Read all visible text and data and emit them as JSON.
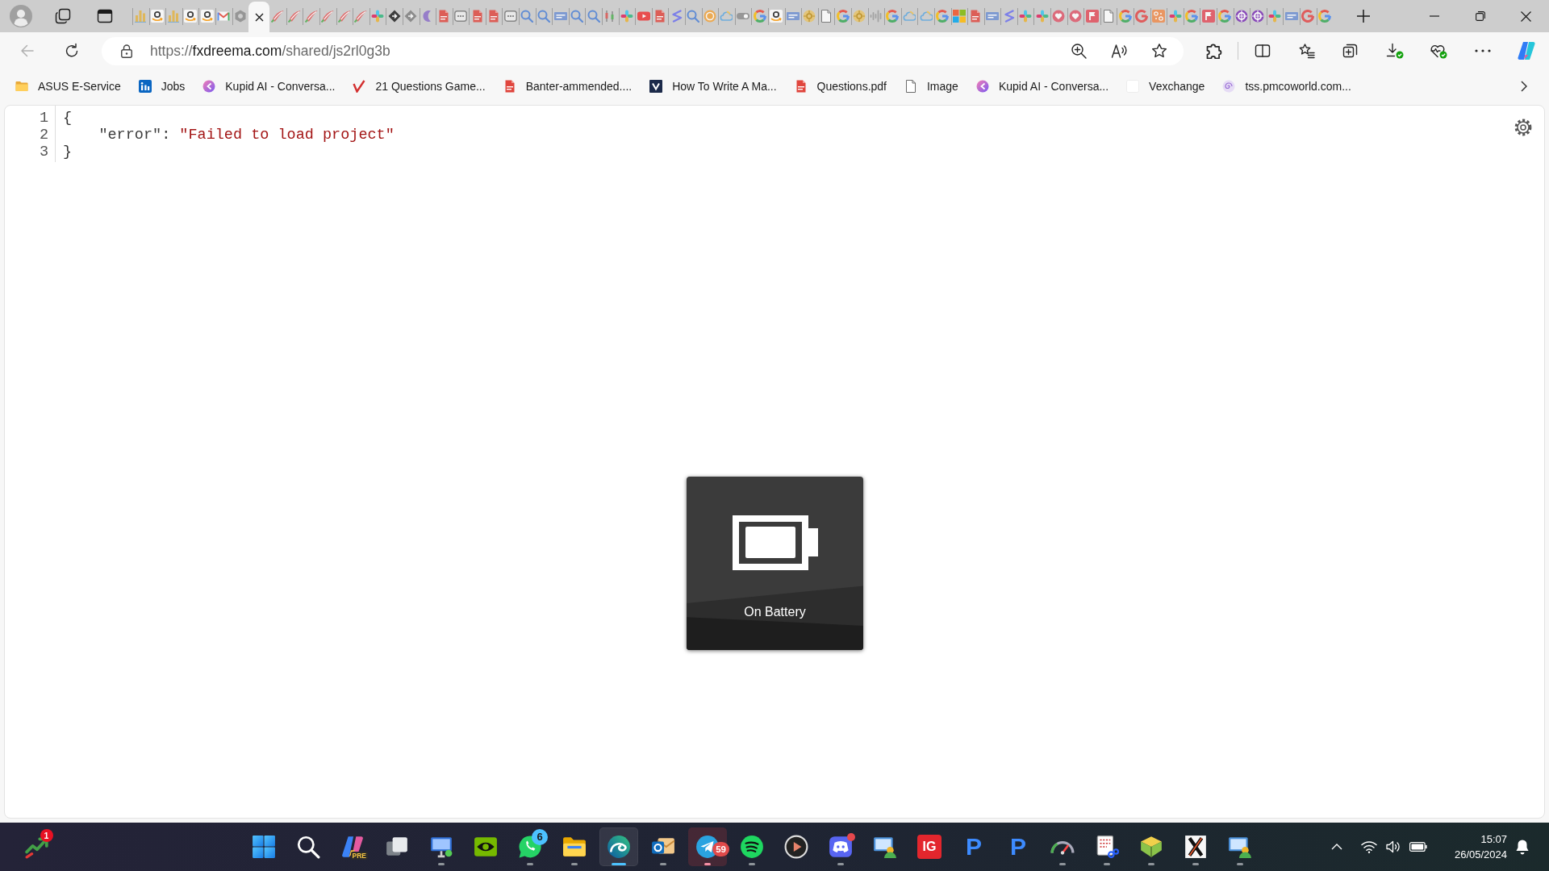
{
  "tab_strip": {
    "tabs": [
      {
        "kind": "bars",
        "selected": false
      },
      {
        "kind": "smile",
        "selected": false
      },
      {
        "kind": "bars",
        "selected": false
      },
      {
        "kind": "smile",
        "selected": false
      },
      {
        "kind": "smile",
        "selected": false
      },
      {
        "kind": "envelope",
        "selected": false
      },
      {
        "kind": "hexagon",
        "selected": false
      },
      {
        "selected": true
      },
      {
        "kind": "swoosh",
        "selected": false
      },
      {
        "kind": "swoosh",
        "selected": false
      },
      {
        "kind": "swoosh",
        "selected": false
      },
      {
        "kind": "swoosh",
        "selected": false
      },
      {
        "kind": "swoosh",
        "selected": false
      },
      {
        "kind": "swoosh",
        "selected": false
      },
      {
        "kind": "dots",
        "selected": false
      },
      {
        "kind": "diamond",
        "selected": false
      },
      {
        "kind": "diamond_light",
        "selected": false
      },
      {
        "kind": "crescent",
        "selected": false
      },
      {
        "kind": "pdf",
        "selected": false
      },
      {
        "kind": "chat",
        "selected": false
      },
      {
        "kind": "pdf",
        "selected": false
      },
      {
        "kind": "pdf",
        "selected": false
      },
      {
        "kind": "chat",
        "selected": false
      },
      {
        "kind": "search",
        "selected": false
      },
      {
        "kind": "search",
        "selected": false
      },
      {
        "kind": "tag",
        "selected": false
      },
      {
        "kind": "search",
        "selected": false
      },
      {
        "kind": "search",
        "selected": false
      },
      {
        "kind": "candles",
        "selected": false
      },
      {
        "kind": "dots",
        "selected": false
      },
      {
        "kind": "play",
        "selected": false
      },
      {
        "kind": "pdf",
        "selected": false
      },
      {
        "kind": "zigzag",
        "selected": false
      },
      {
        "kind": "search",
        "selected": false
      },
      {
        "kind": "coin",
        "selected": false
      },
      {
        "kind": "cloud",
        "selected": false
      },
      {
        "kind": "toggle",
        "selected": false
      },
      {
        "kind": "ring",
        "selected": false
      },
      {
        "kind": "smile",
        "selected": false
      },
      {
        "kind": "tag",
        "selected": false
      },
      {
        "kind": "emblem",
        "selected": false
      },
      {
        "kind": "page",
        "selected": false
      },
      {
        "kind": "ring",
        "selected": false
      },
      {
        "kind": "emblem",
        "selected": false
      },
      {
        "kind": "wave",
        "selected": false
      },
      {
        "kind": "ring",
        "selected": false
      },
      {
        "kind": "cloud",
        "selected": false
      },
      {
        "kind": "cloud",
        "selected": false
      },
      {
        "kind": "ring",
        "selected": false
      },
      {
        "kind": "grid",
        "selected": false
      },
      {
        "kind": "pdf",
        "selected": false
      },
      {
        "kind": "tag",
        "selected": false
      },
      {
        "kind": "zigzag",
        "selected": false
      },
      {
        "kind": "dots",
        "selected": false
      },
      {
        "kind": "dots",
        "selected": false
      },
      {
        "kind": "heart",
        "selected": false
      },
      {
        "kind": "heart",
        "selected": false
      },
      {
        "kind": "flag",
        "selected": false
      },
      {
        "kind": "page",
        "selected": false
      },
      {
        "kind": "ring",
        "selected": false
      },
      {
        "kind": "ring_red",
        "selected": false
      },
      {
        "kind": "pattern",
        "selected": false
      },
      {
        "kind": "dots",
        "selected": false
      },
      {
        "kind": "ring",
        "selected": false
      },
      {
        "kind": "flag",
        "selected": false
      },
      {
        "kind": "ring",
        "selected": false
      },
      {
        "kind": "target",
        "selected": false
      },
      {
        "kind": "target",
        "selected": false
      },
      {
        "kind": "dots",
        "selected": false
      },
      {
        "kind": "tag",
        "selected": false
      },
      {
        "kind": "ring_red",
        "selected": false
      },
      {
        "kind": "ring",
        "selected": false
      }
    ]
  },
  "toolbar": {
    "back": {
      "disabled": true
    },
    "address": {
      "scheme": "https://",
      "host": "fxdreema.com",
      "path": "/shared/js2rl0g3b"
    }
  },
  "bookmarks": {
    "items": [
      {
        "kind": "folder",
        "label": "ASUS E-Service"
      },
      {
        "kind": "tile",
        "label": "Jobs"
      },
      {
        "kind": "chevron_circle",
        "label": "Kupid AI - Conversa..."
      },
      {
        "kind": "tick",
        "label": "21 Questions Game..."
      },
      {
        "kind": "pdf",
        "label": "Banter-ammended...."
      },
      {
        "kind": "chevron_tile",
        "label": "How To Write A Ma..."
      },
      {
        "kind": "pdf",
        "label": "Questions.pdf"
      },
      {
        "kind": "page",
        "label": "Image"
      },
      {
        "kind": "chevron_circle",
        "label": "Kupid AI - Conversa..."
      },
      {
        "kind": "blank",
        "label": "Vexchange"
      },
      {
        "kind": "spiral",
        "label": "tss.pmcoworld.com..."
      }
    ]
  },
  "editor": {
    "lines": [
      {
        "number": "1",
        "kind": "open",
        "tokens": [
          {
            "kind": "punct",
            "text": "{"
          }
        ]
      },
      {
        "number": "2",
        "kind": "member",
        "tokens": [
          {
            "kind": "key",
            "text": "\"error\""
          },
          {
            "kind": "punct",
            "text": ": "
          },
          {
            "kind": "string",
            "text": "\"Failed to load project\""
          }
        ]
      },
      {
        "number": "3",
        "kind": "close",
        "tokens": [
          {
            "kind": "punct",
            "text": "}"
          }
        ]
      }
    ]
  },
  "battery_flyout": {
    "label": "On Battery"
  },
  "taskbar": {
    "widget": {
      "badge": {
        "text": "1",
        "color": "#e81123"
      }
    },
    "apps": [
      {
        "kind": "start",
        "running": false,
        "active": false,
        "alert": false,
        "notify": false
      },
      {
        "kind": "search",
        "running": false,
        "active": false,
        "alert": false,
        "notify": false
      },
      {
        "kind": "ribbon",
        "tag": "PRE",
        "running": false,
        "active": false,
        "alert": false,
        "notify": false
      },
      {
        "kind": "taskview",
        "running": false,
        "active": false,
        "alert": false,
        "notify": false
      },
      {
        "kind": "monitor",
        "running": true,
        "active": false,
        "alert": false,
        "notify": false
      },
      {
        "kind": "eye",
        "running": false,
        "active": false,
        "alert": false,
        "notify": false
      },
      {
        "kind": "phone_bubble",
        "badge": {
          "text": "6",
          "color": "#4cc2ff"
        },
        "running": true,
        "active": false,
        "alert": false,
        "notify": false
      },
      {
        "kind": "folder",
        "running": true,
        "active": false,
        "alert": false,
        "notify": false
      },
      {
        "kind": "wave_circle",
        "running": true,
        "active": true,
        "alert": false,
        "notify": false
      },
      {
        "kind": "mail",
        "running": true,
        "active": false,
        "alert": false,
        "notify": false
      },
      {
        "kind": "plane",
        "badge": {
          "text": "59",
          "color": "#e04a4a"
        },
        "running": true,
        "active": false,
        "alert": true,
        "notify": false
      },
      {
        "kind": "arcs",
        "running": true,
        "active": false,
        "alert": false,
        "notify": false
      },
      {
        "kind": "play",
        "running": false,
        "active": false,
        "alert": false,
        "notify": false
      },
      {
        "kind": "controller",
        "running": true,
        "active": false,
        "alert": false,
        "notify": true
      },
      {
        "kind": "monitor_person",
        "running": false,
        "active": false,
        "alert": false,
        "notify": false
      },
      {
        "kind": "letter_tile",
        "glyph": "IG",
        "running": false,
        "active": false,
        "alert": false,
        "notify": false
      },
      {
        "kind": "letter",
        "glyph": "P",
        "running": false,
        "active": false,
        "alert": false,
        "notify": false
      },
      {
        "kind": "letter",
        "glyph": "P",
        "running": false,
        "active": false,
        "alert": false,
        "notify": false
      },
      {
        "kind": "gauge",
        "running": true,
        "active": false,
        "alert": false,
        "notify": false
      },
      {
        "kind": "snip",
        "running": true,
        "active": false,
        "alert": false,
        "notify": false
      },
      {
        "kind": "book",
        "running": true,
        "active": false,
        "alert": false,
        "notify": false
      },
      {
        "kind": "cross",
        "running": true,
        "active": false,
        "alert": false,
        "notify": false
      },
      {
        "kind": "monitor_person",
        "running": true,
        "active": false,
        "alert": false,
        "notify": false
      }
    ],
    "tray": {
      "time": "15:07",
      "date": "26/05/2024"
    }
  }
}
